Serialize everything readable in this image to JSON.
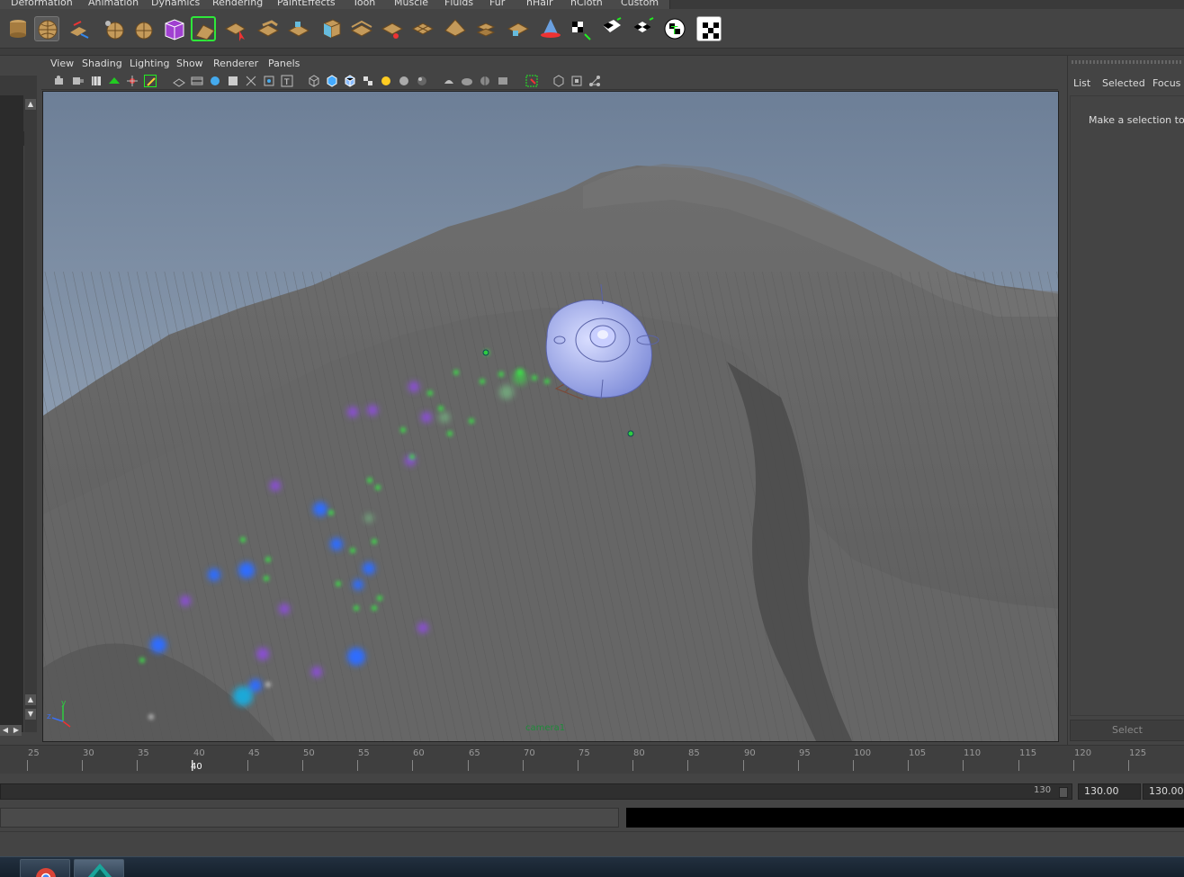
{
  "shelf": {
    "tabs": [
      "Deformation",
      "Animation",
      "Dynamics",
      "Rendering",
      "PaintEffects",
      "Toon",
      "Muscle",
      "Fluids",
      "Fur",
      "nHair",
      "nCloth",
      "Custom"
    ]
  },
  "viewport": {
    "menu": [
      "View",
      "Shading",
      "Lighting",
      "Show",
      "Renderer",
      "Panels"
    ],
    "camera_label": "camera1",
    "axis": {
      "y": "y",
      "z": "z"
    }
  },
  "right_panel": {
    "tabs": [
      "List",
      "Selected",
      "Focus"
    ],
    "message": "Make a selection to vie",
    "select_button": "Select"
  },
  "timeline": {
    "ticks": [
      "25",
      "30",
      "35",
      "40",
      "45",
      "50",
      "55",
      "60",
      "65",
      "70",
      "75",
      "80",
      "85",
      "90",
      "95",
      "100",
      "105",
      "110",
      "115",
      "120",
      "125"
    ],
    "current_frame": "40"
  },
  "range": {
    "end_label": "130",
    "end_time": "130.00",
    "playback_end": "130.00"
  },
  "colors": {
    "sky_top": "#6d7f97",
    "sky_bottom": "#a9b7c7",
    "terrain": "#6a6a6a",
    "particle_green": "#3ddc4a",
    "particle_blue": "#2f6dff",
    "particle_purple": "#8a4fd4",
    "object": "#9aa6e6"
  },
  "icons": [
    "cylinder-icon",
    "sphere-mesh-icon",
    "extrude-icon",
    "polysphere-icon",
    "polysphere-icon",
    "cube-purple-icon",
    "selected-tool-icon",
    "select-arrow-icon",
    "plane-icon",
    "plane-icon",
    "cube-icon",
    "plane-icon",
    "plane-icon",
    "plane-icon",
    "plane-icon",
    "plane-icon",
    "plane-icon",
    "plane-icon",
    "plane-icon",
    "cone-icon",
    "checker-icon",
    "checker-icon",
    "checker-icon",
    "checker-icon",
    "checker-icon"
  ],
  "taskbar": [
    "chrome-icon",
    "maya-icon"
  ]
}
